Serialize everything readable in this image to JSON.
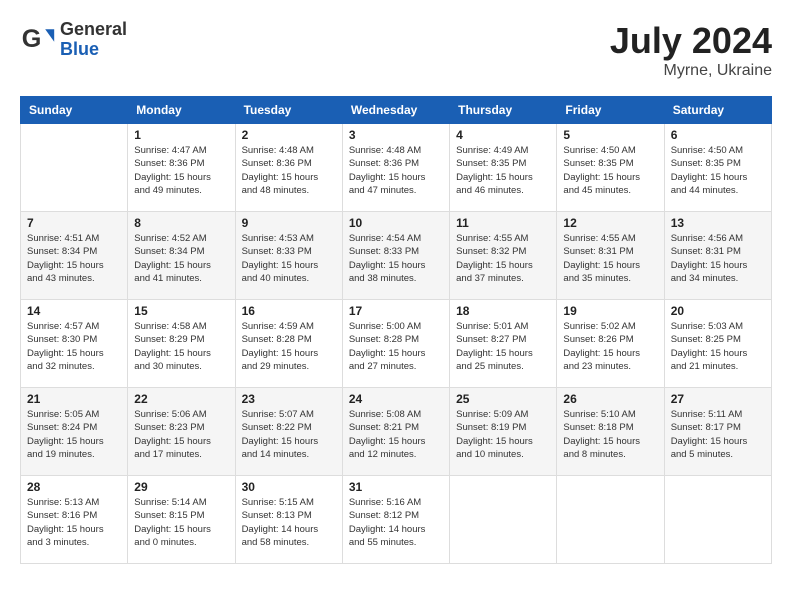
{
  "header": {
    "logo_general": "General",
    "logo_blue": "Blue",
    "month_year": "July 2024",
    "location": "Myrne, Ukraine"
  },
  "weekdays": [
    "Sunday",
    "Monday",
    "Tuesday",
    "Wednesday",
    "Thursday",
    "Friday",
    "Saturday"
  ],
  "weeks": [
    [
      {
        "day": "",
        "info": ""
      },
      {
        "day": "1",
        "info": "Sunrise: 4:47 AM\nSunset: 8:36 PM\nDaylight: 15 hours\nand 49 minutes."
      },
      {
        "day": "2",
        "info": "Sunrise: 4:48 AM\nSunset: 8:36 PM\nDaylight: 15 hours\nand 48 minutes."
      },
      {
        "day": "3",
        "info": "Sunrise: 4:48 AM\nSunset: 8:36 PM\nDaylight: 15 hours\nand 47 minutes."
      },
      {
        "day": "4",
        "info": "Sunrise: 4:49 AM\nSunset: 8:35 PM\nDaylight: 15 hours\nand 46 minutes."
      },
      {
        "day": "5",
        "info": "Sunrise: 4:50 AM\nSunset: 8:35 PM\nDaylight: 15 hours\nand 45 minutes."
      },
      {
        "day": "6",
        "info": "Sunrise: 4:50 AM\nSunset: 8:35 PM\nDaylight: 15 hours\nand 44 minutes."
      }
    ],
    [
      {
        "day": "7",
        "info": "Sunrise: 4:51 AM\nSunset: 8:34 PM\nDaylight: 15 hours\nand 43 minutes."
      },
      {
        "day": "8",
        "info": "Sunrise: 4:52 AM\nSunset: 8:34 PM\nDaylight: 15 hours\nand 41 minutes."
      },
      {
        "day": "9",
        "info": "Sunrise: 4:53 AM\nSunset: 8:33 PM\nDaylight: 15 hours\nand 40 minutes."
      },
      {
        "day": "10",
        "info": "Sunrise: 4:54 AM\nSunset: 8:33 PM\nDaylight: 15 hours\nand 38 minutes."
      },
      {
        "day": "11",
        "info": "Sunrise: 4:55 AM\nSunset: 8:32 PM\nDaylight: 15 hours\nand 37 minutes."
      },
      {
        "day": "12",
        "info": "Sunrise: 4:55 AM\nSunset: 8:31 PM\nDaylight: 15 hours\nand 35 minutes."
      },
      {
        "day": "13",
        "info": "Sunrise: 4:56 AM\nSunset: 8:31 PM\nDaylight: 15 hours\nand 34 minutes."
      }
    ],
    [
      {
        "day": "14",
        "info": "Sunrise: 4:57 AM\nSunset: 8:30 PM\nDaylight: 15 hours\nand 32 minutes."
      },
      {
        "day": "15",
        "info": "Sunrise: 4:58 AM\nSunset: 8:29 PM\nDaylight: 15 hours\nand 30 minutes."
      },
      {
        "day": "16",
        "info": "Sunrise: 4:59 AM\nSunset: 8:28 PM\nDaylight: 15 hours\nand 29 minutes."
      },
      {
        "day": "17",
        "info": "Sunrise: 5:00 AM\nSunset: 8:28 PM\nDaylight: 15 hours\nand 27 minutes."
      },
      {
        "day": "18",
        "info": "Sunrise: 5:01 AM\nSunset: 8:27 PM\nDaylight: 15 hours\nand 25 minutes."
      },
      {
        "day": "19",
        "info": "Sunrise: 5:02 AM\nSunset: 8:26 PM\nDaylight: 15 hours\nand 23 minutes."
      },
      {
        "day": "20",
        "info": "Sunrise: 5:03 AM\nSunset: 8:25 PM\nDaylight: 15 hours\nand 21 minutes."
      }
    ],
    [
      {
        "day": "21",
        "info": "Sunrise: 5:05 AM\nSunset: 8:24 PM\nDaylight: 15 hours\nand 19 minutes."
      },
      {
        "day": "22",
        "info": "Sunrise: 5:06 AM\nSunset: 8:23 PM\nDaylight: 15 hours\nand 17 minutes."
      },
      {
        "day": "23",
        "info": "Sunrise: 5:07 AM\nSunset: 8:22 PM\nDaylight: 15 hours\nand 14 minutes."
      },
      {
        "day": "24",
        "info": "Sunrise: 5:08 AM\nSunset: 8:21 PM\nDaylight: 15 hours\nand 12 minutes."
      },
      {
        "day": "25",
        "info": "Sunrise: 5:09 AM\nSunset: 8:19 PM\nDaylight: 15 hours\nand 10 minutes."
      },
      {
        "day": "26",
        "info": "Sunrise: 5:10 AM\nSunset: 8:18 PM\nDaylight: 15 hours\nand 8 minutes."
      },
      {
        "day": "27",
        "info": "Sunrise: 5:11 AM\nSunset: 8:17 PM\nDaylight: 15 hours\nand 5 minutes."
      }
    ],
    [
      {
        "day": "28",
        "info": "Sunrise: 5:13 AM\nSunset: 8:16 PM\nDaylight: 15 hours\nand 3 minutes."
      },
      {
        "day": "29",
        "info": "Sunrise: 5:14 AM\nSunset: 8:15 PM\nDaylight: 15 hours\nand 0 minutes."
      },
      {
        "day": "30",
        "info": "Sunrise: 5:15 AM\nSunset: 8:13 PM\nDaylight: 14 hours\nand 58 minutes."
      },
      {
        "day": "31",
        "info": "Sunrise: 5:16 AM\nSunset: 8:12 PM\nDaylight: 14 hours\nand 55 minutes."
      },
      {
        "day": "",
        "info": ""
      },
      {
        "day": "",
        "info": ""
      },
      {
        "day": "",
        "info": ""
      }
    ]
  ]
}
